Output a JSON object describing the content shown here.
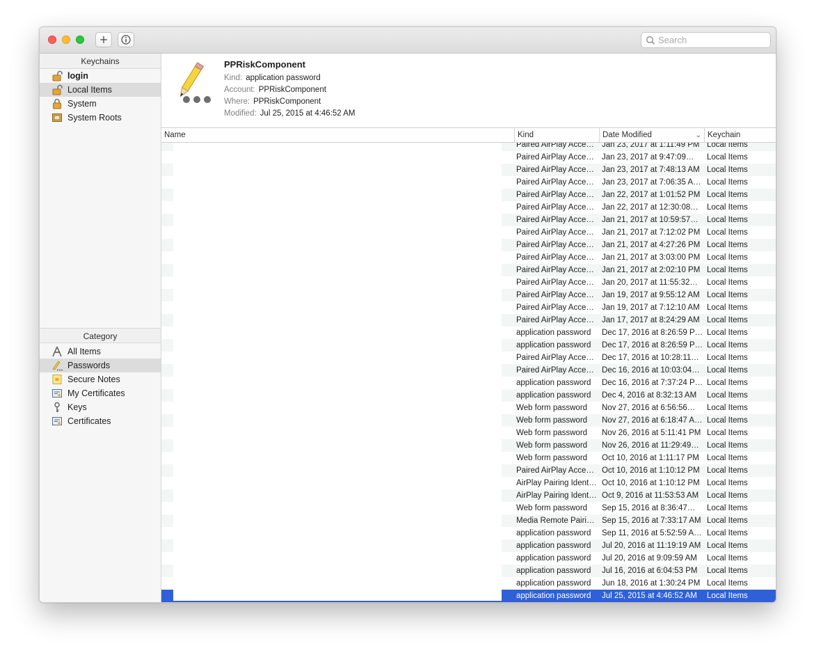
{
  "search": {
    "placeholder": "Search"
  },
  "sidebar": {
    "keychains_header": "Keychains",
    "keychains": [
      {
        "label": "login",
        "icon": "lock-open-icon",
        "bold": true
      },
      {
        "label": "Local Items",
        "icon": "lock-open-icon",
        "selected": true
      },
      {
        "label": "System",
        "icon": "lock-icon"
      },
      {
        "label": "System Roots",
        "icon": "cabinet-icon"
      }
    ],
    "category_header": "Category",
    "categories": [
      {
        "label": "All Items",
        "icon": "all-items-icon"
      },
      {
        "label": "Passwords",
        "icon": "pencil-icon",
        "selected": true
      },
      {
        "label": "Secure Notes",
        "icon": "note-icon"
      },
      {
        "label": "My Certificates",
        "icon": "certificate-icon"
      },
      {
        "label": "Keys",
        "icon": "key-icon"
      },
      {
        "label": "Certificates",
        "icon": "certificate-icon"
      }
    ]
  },
  "detail": {
    "title": "PPRiskComponent",
    "kind_label": "Kind:",
    "kind": "application password",
    "account_label": "Account:",
    "account": "PPRiskComponent",
    "where_label": "Where:",
    "where": "PPRiskComponent",
    "modified_label": "Modified:",
    "modified": "Jul 25, 2015 at 4:46:52 AM"
  },
  "table": {
    "columns": {
      "name": "Name",
      "kind": "Kind",
      "date": "Date Modified",
      "keychain": "Keychain"
    },
    "rows": [
      {
        "kind": "Paired AirPlay Acce…",
        "date": "Jan 23, 2017 at 1:11:49 PM",
        "keychain": "Local Items"
      },
      {
        "kind": "Paired AirPlay Acce…",
        "date": "Jan 23, 2017 at 9:47:09…",
        "keychain": "Local Items"
      },
      {
        "kind": "Paired AirPlay Acce…",
        "date": "Jan 23, 2017 at 7:48:13 AM",
        "keychain": "Local Items"
      },
      {
        "kind": "Paired AirPlay Acce…",
        "date": "Jan 23, 2017 at 7:06:35 A…",
        "keychain": "Local Items"
      },
      {
        "kind": "Paired AirPlay Acce…",
        "date": "Jan 22, 2017 at 1:01:52 PM",
        "keychain": "Local Items"
      },
      {
        "kind": "Paired AirPlay Acce…",
        "date": "Jan 22, 2017 at 12:30:08…",
        "keychain": "Local Items"
      },
      {
        "kind": "Paired AirPlay Acce…",
        "date": "Jan 21, 2017 at 10:59:57…",
        "keychain": "Local Items"
      },
      {
        "kind": "Paired AirPlay Acce…",
        "date": "Jan 21, 2017 at 7:12:02 PM",
        "keychain": "Local Items"
      },
      {
        "kind": "Paired AirPlay Acce…",
        "date": "Jan 21, 2017 at 4:27:26 PM",
        "keychain": "Local Items"
      },
      {
        "kind": "Paired AirPlay Acce…",
        "date": "Jan 21, 2017 at 3:03:00 PM",
        "keychain": "Local Items"
      },
      {
        "kind": "Paired AirPlay Acce…",
        "date": "Jan 21, 2017 at 2:02:10 PM",
        "keychain": "Local Items"
      },
      {
        "kind": "Paired AirPlay Acce…",
        "date": "Jan 20, 2017 at 11:55:32…",
        "keychain": "Local Items"
      },
      {
        "kind": "Paired AirPlay Acce…",
        "date": "Jan 19, 2017 at 9:55:12 AM",
        "keychain": "Local Items"
      },
      {
        "kind": "Paired AirPlay Acce…",
        "date": "Jan 19, 2017 at 7:12:10 AM",
        "keychain": "Local Items"
      },
      {
        "kind": "Paired AirPlay Acce…",
        "date": "Jan 17, 2017 at 8:24:29 AM",
        "keychain": "Local Items"
      },
      {
        "kind": "application password",
        "date": "Dec 17, 2016 at 8:26:59 P…",
        "keychain": "Local Items"
      },
      {
        "kind": "application password",
        "date": "Dec 17, 2016 at 8:26:59 P…",
        "keychain": "Local Items"
      },
      {
        "kind": "Paired AirPlay Acce…",
        "date": "Dec 17, 2016 at 10:28:11…",
        "keychain": "Local Items"
      },
      {
        "kind": "Paired AirPlay Acce…",
        "date": "Dec 16, 2016 at 10:03:04…",
        "keychain": "Local Items"
      },
      {
        "kind": "application password",
        "date": "Dec 16, 2016 at 7:37:24 P…",
        "keychain": "Local Items"
      },
      {
        "kind": "application password",
        "date": "Dec 4, 2016 at 8:32:13 AM",
        "keychain": "Local Items"
      },
      {
        "kind": "Web form password",
        "date": "Nov 27, 2016 at 6:56:56…",
        "keychain": "Local Items"
      },
      {
        "kind": "Web form password",
        "date": "Nov 27, 2016 at 6:18:47 A…",
        "keychain": "Local Items"
      },
      {
        "kind": "Web form password",
        "date": "Nov 26, 2016 at 5:11:41 PM",
        "keychain": "Local Items"
      },
      {
        "kind": "Web form password",
        "date": "Nov 26, 2016 at 11:29:49…",
        "keychain": "Local Items"
      },
      {
        "kind": "Web form password",
        "date": "Oct 10, 2016 at 1:11:17 PM",
        "keychain": "Local Items"
      },
      {
        "kind": "Paired AirPlay Acce…",
        "date": "Oct 10, 2016 at 1:10:12 PM",
        "keychain": "Local Items"
      },
      {
        "kind": "AirPlay Pairing Ident…",
        "date": "Oct 10, 2016 at 1:10:12 PM",
        "keychain": "Local Items"
      },
      {
        "kind": "AirPlay Pairing Ident…",
        "date": "Oct 9, 2016 at 11:53:53 AM",
        "keychain": "Local Items"
      },
      {
        "kind": "Web form password",
        "date": "Sep 15, 2016 at 8:36:47…",
        "keychain": "Local Items"
      },
      {
        "kind": "Media Remote Pairi…",
        "date": "Sep 15, 2016 at 7:33:17 AM",
        "keychain": "Local Items"
      },
      {
        "kind": "application password",
        "date": "Sep 11, 2016 at 5:52:59 A…",
        "keychain": "Local Items"
      },
      {
        "kind": "application password",
        "date": "Jul 20, 2016 at 11:19:19 AM",
        "keychain": "Local Items"
      },
      {
        "kind": "application password",
        "date": "Jul 20, 2016 at 9:09:59 AM",
        "keychain": "Local Items"
      },
      {
        "kind": "application password",
        "date": "Jul 16, 2016 at 6:04:53 PM",
        "keychain": "Local Items"
      },
      {
        "kind": "application password",
        "date": "Jun 18, 2016 at 1:30:24 PM",
        "keychain": "Local Items"
      },
      {
        "kind": "application password",
        "date": "Jul 25, 2015 at 4:46:52 AM",
        "keychain": "Local Items",
        "selected": true
      }
    ]
  },
  "colors": {
    "selection": "#2f60d8",
    "alt_row": "#f4f5f5",
    "sidebar_selected": "#dcdcdc"
  }
}
